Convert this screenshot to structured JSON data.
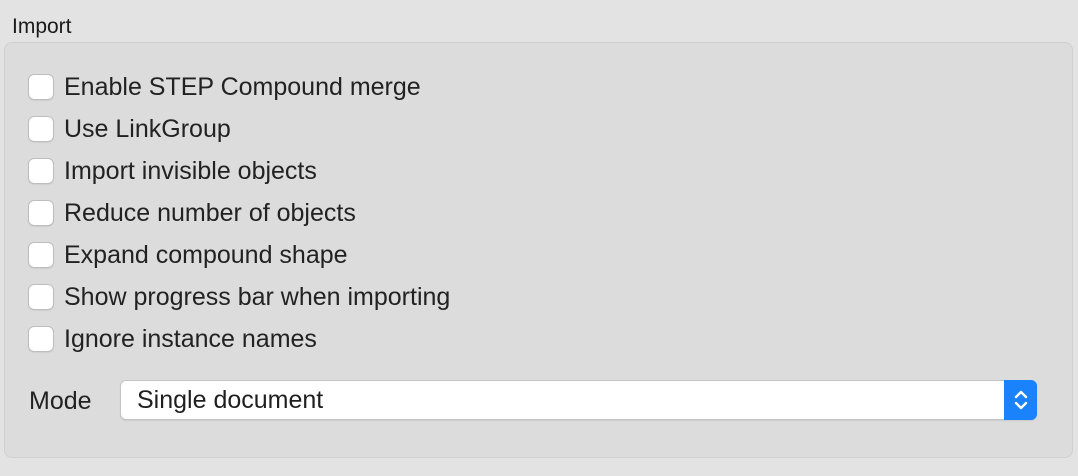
{
  "section": {
    "title": "Import"
  },
  "options": [
    {
      "label": "Enable STEP Compound merge",
      "checked": false
    },
    {
      "label": "Use LinkGroup",
      "checked": false
    },
    {
      "label": "Import invisible objects",
      "checked": false
    },
    {
      "label": "Reduce number of objects",
      "checked": false
    },
    {
      "label": "Expand compound shape",
      "checked": false
    },
    {
      "label": "Show progress bar when importing",
      "checked": false
    },
    {
      "label": "Ignore instance names",
      "checked": false
    }
  ],
  "mode": {
    "label": "Mode",
    "selected": "Single document"
  },
  "colors": {
    "accent": "#1a82fb",
    "background": "#e3e3e3",
    "panel": "#dcdcdc"
  },
  "icons": {
    "stepper": "up-down-chevrons-icon"
  }
}
